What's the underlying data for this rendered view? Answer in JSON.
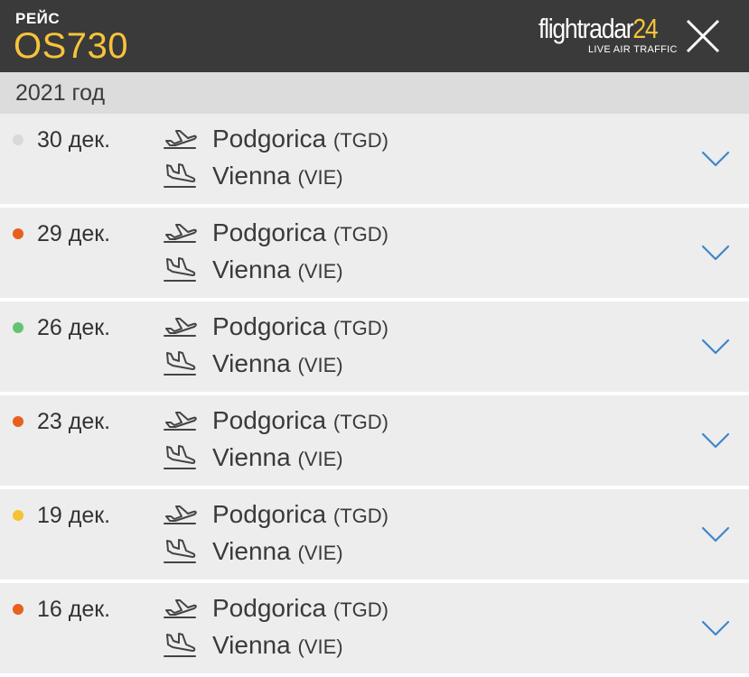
{
  "header": {
    "label": "РЕЙС",
    "flight_number": "OS730",
    "logo_text": "flightradar",
    "logo_accent": "24",
    "logo_sub": "LIVE AIR TRAFFIC",
    "accent_color": "#f7c33b"
  },
  "year": "2021 год",
  "flights": [
    {
      "date": "30 дек.",
      "status_color": "#d9d9d9",
      "from_city": "Podgorica",
      "from_code": "(TGD)",
      "to_city": "Vienna",
      "to_code": "(VIE)"
    },
    {
      "date": "29 дек.",
      "status_color": "#e8601c",
      "from_city": "Podgorica",
      "from_code": "(TGD)",
      "to_city": "Vienna",
      "to_code": "(VIE)"
    },
    {
      "date": "26 дек.",
      "status_color": "#63c373",
      "from_city": "Podgorica",
      "from_code": "(TGD)",
      "to_city": "Vienna",
      "to_code": "(VIE)"
    },
    {
      "date": "23 дек.",
      "status_color": "#e8601c",
      "from_city": "Podgorica",
      "from_code": "(TGD)",
      "to_city": "Vienna",
      "to_code": "(VIE)"
    },
    {
      "date": "19 дек.",
      "status_color": "#f5c233",
      "from_city": "Podgorica",
      "from_code": "(TGD)",
      "to_city": "Vienna",
      "to_code": "(VIE)"
    },
    {
      "date": "16 дек.",
      "status_color": "#e8601c",
      "from_city": "Podgorica",
      "from_code": "(TGD)",
      "to_city": "Vienna",
      "to_code": "(VIE)"
    }
  ]
}
